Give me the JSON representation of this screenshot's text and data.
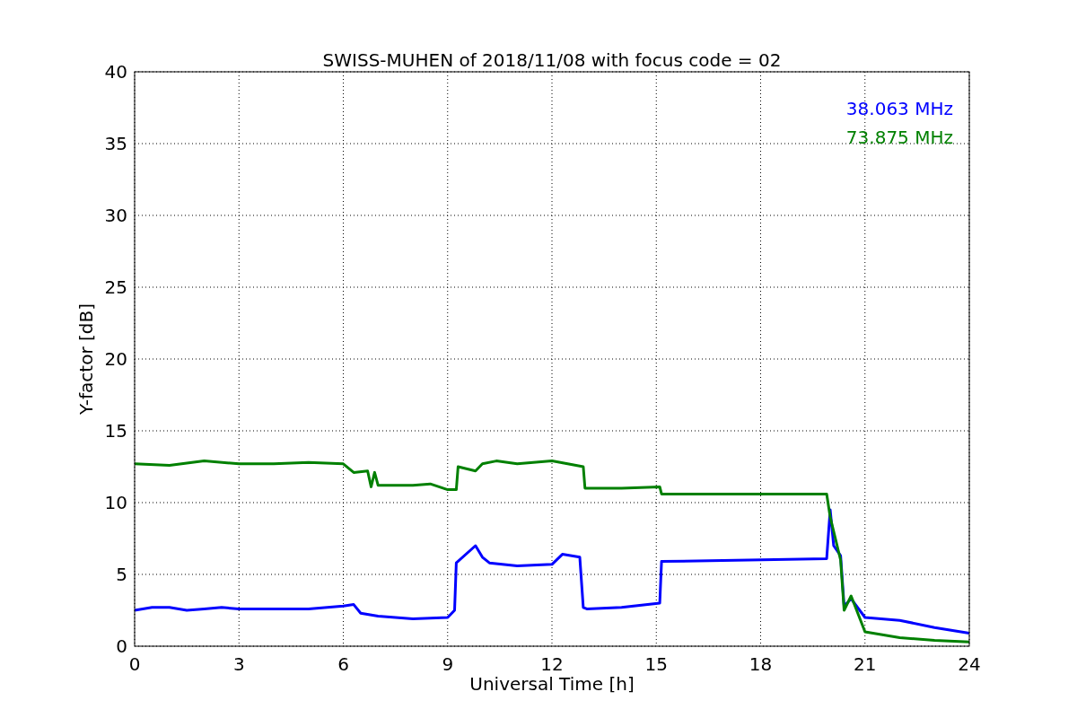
{
  "figure": {
    "chart_data": {
      "type": "line",
      "title": "SWISS-MUHEN of 2018/11/08 with focus code = 02",
      "xlabel": "Universal Time [h]",
      "ylabel": "Y-factor [dB]",
      "grid": true,
      "xlim": [
        0,
        24
      ],
      "ylim": [
        0,
        40
      ],
      "xticks": [
        0,
        3,
        6,
        9,
        12,
        15,
        18,
        21,
        24
      ],
      "yticks": [
        0,
        5,
        10,
        15,
        20,
        25,
        30,
        35,
        40
      ],
      "series": [
        {
          "name": "38.063 MHz",
          "color": "#0000ff",
          "x": [
            0,
            0.5,
            1,
            1.5,
            2,
            2.5,
            3,
            4,
            5,
            6,
            6.3,
            6.5,
            7,
            8,
            9,
            9.2,
            9.25,
            9.8,
            10,
            10.2,
            11,
            12,
            12.3,
            12.8,
            12.9,
            13,
            14,
            15.1,
            15.15,
            19.9,
            20,
            20.1,
            20.3,
            20.4,
            20.6,
            21,
            22,
            23,
            24
          ],
          "values": [
            2.5,
            2.7,
            2.7,
            2.5,
            2.6,
            2.7,
            2.6,
            2.6,
            2.6,
            2.8,
            2.9,
            2.3,
            2.1,
            1.9,
            2.0,
            2.5,
            5.8,
            7.0,
            6.2,
            5.8,
            5.6,
            5.7,
            6.4,
            6.2,
            2.7,
            2.6,
            2.7,
            3.0,
            5.9,
            6.1,
            9.5,
            7.0,
            6.3,
            2.8,
            3.3,
            2.0,
            1.8,
            1.3,
            0.9
          ]
        },
        {
          "name": "73.875 MHz",
          "color": "#008000",
          "x": [
            0,
            1,
            2,
            3,
            4,
            5,
            6,
            6.3,
            6.7,
            6.8,
            6.9,
            7,
            8,
            8.5,
            9,
            9.25,
            9.3,
            9.8,
            10,
            10.4,
            11,
            12,
            12.9,
            12.95,
            14,
            15.1,
            15.15,
            19.9,
            20,
            20.3,
            20.4,
            20.6,
            21,
            22,
            23,
            24
          ],
          "values": [
            12.7,
            12.6,
            12.9,
            12.7,
            12.7,
            12.8,
            12.7,
            12.1,
            12.2,
            11.1,
            12.1,
            11.2,
            11.2,
            11.3,
            10.9,
            10.9,
            12.5,
            12.2,
            12.7,
            12.9,
            12.7,
            12.9,
            12.5,
            11.0,
            11.0,
            11.1,
            10.6,
            10.6,
            9.0,
            6.0,
            2.5,
            3.5,
            1.0,
            0.6,
            0.4,
            0.3
          ]
        }
      ]
    }
  }
}
